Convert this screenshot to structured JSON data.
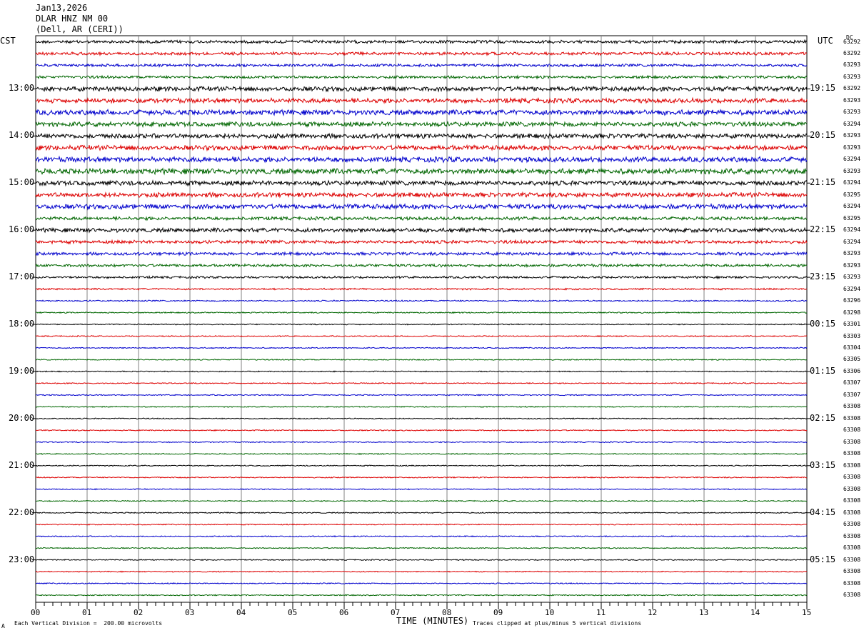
{
  "header": {
    "date": "Jan13,2026",
    "station": "DLAR HNZ NM 00",
    "location": "(Dell, AR (CERI))"
  },
  "left_tz": "CST",
  "right_tz": "UTC",
  "dc_header": "DC",
  "footer": {
    "scale": "Each Vertical Division =  200.00 microvolts",
    "clip": "Traces clipped at plus/minus 5 vertical divisions",
    "corner": "A",
    "xlabel": "TIME (MINUTES)"
  },
  "colors": {
    "trace_cycle": [
      "#000000",
      "#dd0000",
      "#0000cc",
      "#006600"
    ],
    "grid": "#808080"
  },
  "chart_data": {
    "type": "line",
    "title": "",
    "xlabel": "TIME (MINUTES)",
    "xlim": [
      0,
      15
    ],
    "x_ticks": [
      "00",
      "01",
      "02",
      "03",
      "04",
      "05",
      "06",
      "07",
      "08",
      "09",
      "10",
      "11",
      "12",
      "13",
      "14",
      "15"
    ],
    "left_hour_labels": [
      "13:00",
      "14:00",
      "15:00",
      "16:00",
      "17:00",
      "18:00",
      "19:00",
      "20:00",
      "21:00",
      "22:00",
      "23:00"
    ],
    "right_hour_labels": [
      "19:15",
      "20:15",
      "21:15",
      "22:15",
      "23:15",
      "00:15",
      "01:15",
      "02:15",
      "03:15",
      "04:15",
      "05:15"
    ],
    "trace_count": 48,
    "dc_offsets": [
      "63292",
      "63292",
      "63293",
      "63293",
      "63292",
      "63293",
      "63293",
      "63294",
      "63293",
      "63293",
      "63294",
      "63293",
      "63294",
      "63295",
      "63294",
      "63295",
      "63294",
      "63294",
      "63293",
      "63293",
      "63293",
      "63294",
      "63296",
      "63298",
      "63301",
      "63303",
      "63304",
      "63305",
      "63306",
      "63307",
      "63307",
      "63308",
      "63308",
      "63308",
      "63308",
      "63308",
      "63308",
      "63308",
      "63308",
      "63308",
      "63308",
      "63308",
      "63308",
      "63308",
      "63308",
      "63308",
      "63308",
      "63308"
    ],
    "relative_amplitude": [
      0.55,
      0.55,
      0.5,
      0.5,
      0.85,
      0.85,
      0.95,
      0.85,
      0.85,
      0.9,
      0.95,
      1.0,
      0.85,
      0.85,
      0.9,
      0.6,
      0.75,
      0.6,
      0.55,
      0.5,
      0.4,
      0.3,
      0.25,
      0.22,
      0.2,
      0.2,
      0.2,
      0.2,
      0.2,
      0.2,
      0.2,
      0.2,
      0.2,
      0.2,
      0.2,
      0.2,
      0.2,
      0.2,
      0.2,
      0.2,
      0.2,
      0.2,
      0.2,
      0.2,
      0.2,
      0.2,
      0.2,
      0.2
    ]
  }
}
